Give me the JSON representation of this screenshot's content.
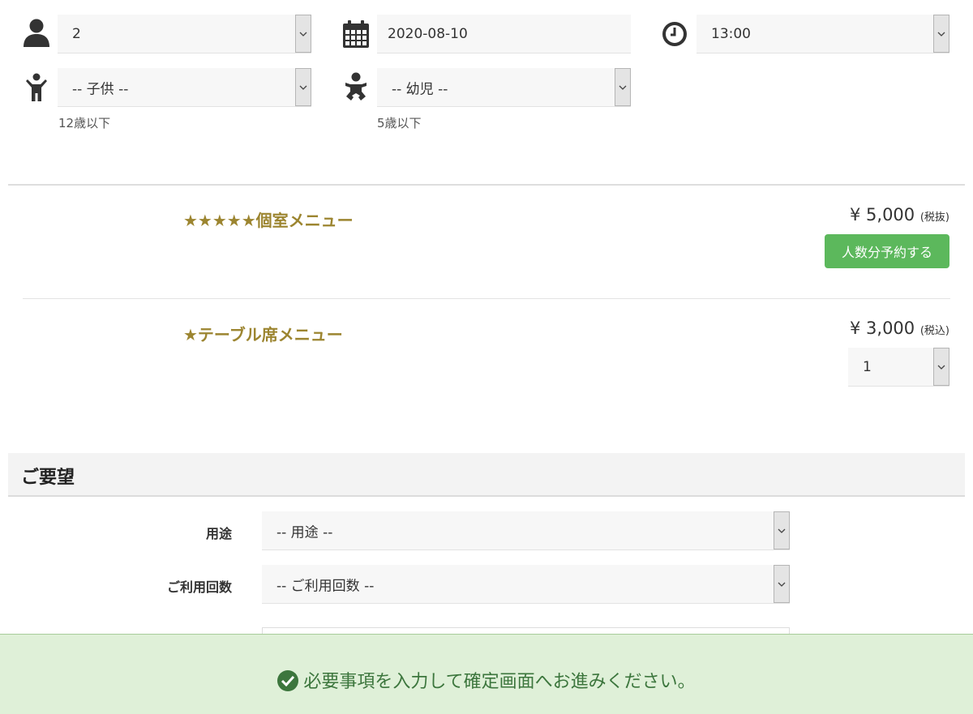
{
  "reservation": {
    "adults": {
      "value": "2",
      "icon": "person-icon"
    },
    "date": {
      "value": "2020-08-10",
      "icon": "calendar-icon"
    },
    "time": {
      "value": "13:00",
      "icon": "clock-icon"
    },
    "children": {
      "value": "-- 子供 --",
      "hint": "12歳以下",
      "icon": "child-icon"
    },
    "infants": {
      "value": "-- 幼児 --",
      "hint": "5歳以下",
      "icon": "baby-icon"
    }
  },
  "menus": [
    {
      "title": "★★★★★個室メニュー",
      "price": "¥ 5,000",
      "tax_note": "(税抜)",
      "action_label": "人数分予約する"
    },
    {
      "title": "★テーブル席メニュー",
      "price": "¥ 3,000",
      "tax_note": "(税込)",
      "quantity": "1"
    }
  ],
  "requests": {
    "heading": "ご要望",
    "purpose": {
      "label": "用途",
      "value": "-- 用途 --"
    },
    "visit_count": {
      "label": "ご利用回数",
      "value": "-- ご利用回数 --"
    }
  },
  "footer": {
    "message": "必要事項を入力して確定画面へお進みください。"
  },
  "colors": {
    "menu_title": "#9c8530",
    "book_button": "#5cb85c",
    "footer_bg": "#dff0d8",
    "footer_text": "#3c763d"
  }
}
